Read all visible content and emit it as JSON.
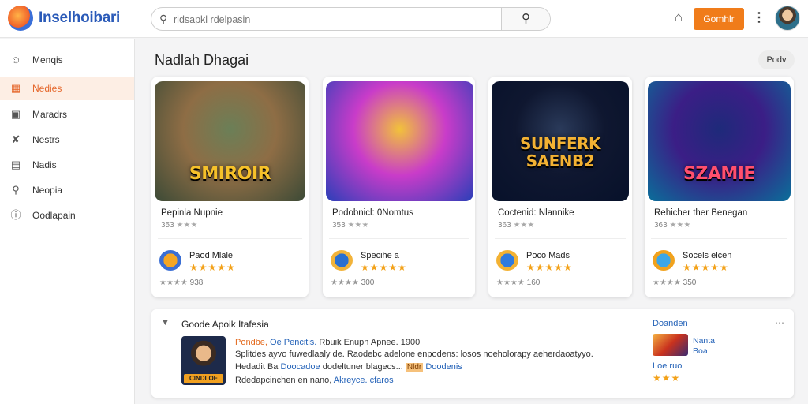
{
  "header": {
    "brand": "Inselhoibari",
    "search_placeholder": "ridsapkl rdelpasin",
    "cta_label": "Gomhlr",
    "icons": [
      "app-logo",
      "search-icon",
      "home-icon",
      "more-vert-icon",
      "user-avatar"
    ]
  },
  "sidebar": {
    "items": [
      {
        "label": "Menqis",
        "icon": "user-icon",
        "active": false
      },
      {
        "label": "Nedies",
        "icon": "calendar-icon",
        "active": true
      },
      {
        "label": "Maradrs",
        "icon": "box-icon",
        "active": false
      },
      {
        "label": "Nestrs",
        "icon": "tools-icon",
        "active": false
      },
      {
        "label": "Nadis",
        "icon": "news-icon",
        "active": false
      },
      {
        "label": "Neopia",
        "icon": "search-icon",
        "active": false
      },
      {
        "label": "Oodlapain",
        "icon": "info-icon",
        "active": false
      }
    ]
  },
  "main": {
    "section_title": "Nadlah Dhagai",
    "view_button": "Podv",
    "cards": [
      {
        "art_text": "SMIROIR",
        "art_colors": [
          "#6b7f57",
          "#8e6d45",
          "#3c4a36"
        ],
        "art_text_color": "#f6c12a",
        "name": "Pepinla Nupnie",
        "name_color": "#222222",
        "rating_text": "353",
        "sub_title": "Paod Mlale",
        "sub_icon": "shield-badge-icon",
        "badge_colors": [
          "#f5a623",
          "#3b6fd4"
        ],
        "stars_line": "★★★★★",
        "mini": "938"
      },
      {
        "art_text": "",
        "art_colors": [
          "#f2c23a",
          "#c93cc9",
          "#2a3fb8"
        ],
        "art_text_color": "#ffffff",
        "name": "Podobnicl: 0Nomtus",
        "name_color": "#2563b8",
        "rating_text": "353",
        "sub_title": "Specihe a",
        "sub_icon": "chest-badge-icon",
        "badge_colors": [
          "#2a6fd0",
          "#f2b33a"
        ],
        "stars_line": "★★★★★",
        "mini": "300"
      },
      {
        "art_text": "SUNFERK SAENB2",
        "art_colors": [
          "#2a3a5a",
          "#0f1730",
          "#07112a"
        ],
        "art_text_color": "#f3b233",
        "name": "Coctenid: Nlannike",
        "name_color": "#222222",
        "rating_text": "363",
        "sub_title": "Poco Mads",
        "sub_icon": "globe-badge-icon",
        "badge_colors": [
          "#2f7be0",
          "#f3b233"
        ],
        "stars_line": "★★★★★",
        "mini": "160"
      },
      {
        "art_text": "SZAMIE",
        "art_colors": [
          "#1e2a7a",
          "#3b1e86",
          "#0a6f9a"
        ],
        "art_text_color": "#ff4f6e",
        "name": "Rehicher ther Benegan",
        "name_color": "#2563b8",
        "rating_text": "363",
        "sub_title": "Socels elcen",
        "sub_icon": "star-badge-icon",
        "badge_colors": [
          "#3ca6e6",
          "#f1a21d"
        ],
        "stars_line": "★★★★★",
        "mini": "350"
      }
    ]
  },
  "panel": {
    "title": "Goode Apoik Itafesia",
    "line1_a": "Pondbe,",
    "line1_b": "Oe Pencitis.",
    "line1_c": "Rbuik Enupn Apnee.",
    "line1_d": "1900",
    "line2": "Splitdes ayvo fuwedlaaly de. Raodebc adelone enpodens: losos noeholorapy aeherdaoatyyo.",
    "line3_a": "Hedadit Ba",
    "line3_b": "Doocadoe",
    "line3_c": "dodeltuner blagecs...",
    "line3_tag": "Nldr",
    "line3_d": "Doodenis",
    "line4_a": "Rdedapcinchen en nano,",
    "line4_b": "Akreyce. cfaros",
    "thumb_tag": "CINDLOE",
    "side_label": "Doanden",
    "side_text_1": "Nanta",
    "side_text_2": "Boa",
    "side_sub": "Loe ruo",
    "side_stars": "★★★"
  }
}
